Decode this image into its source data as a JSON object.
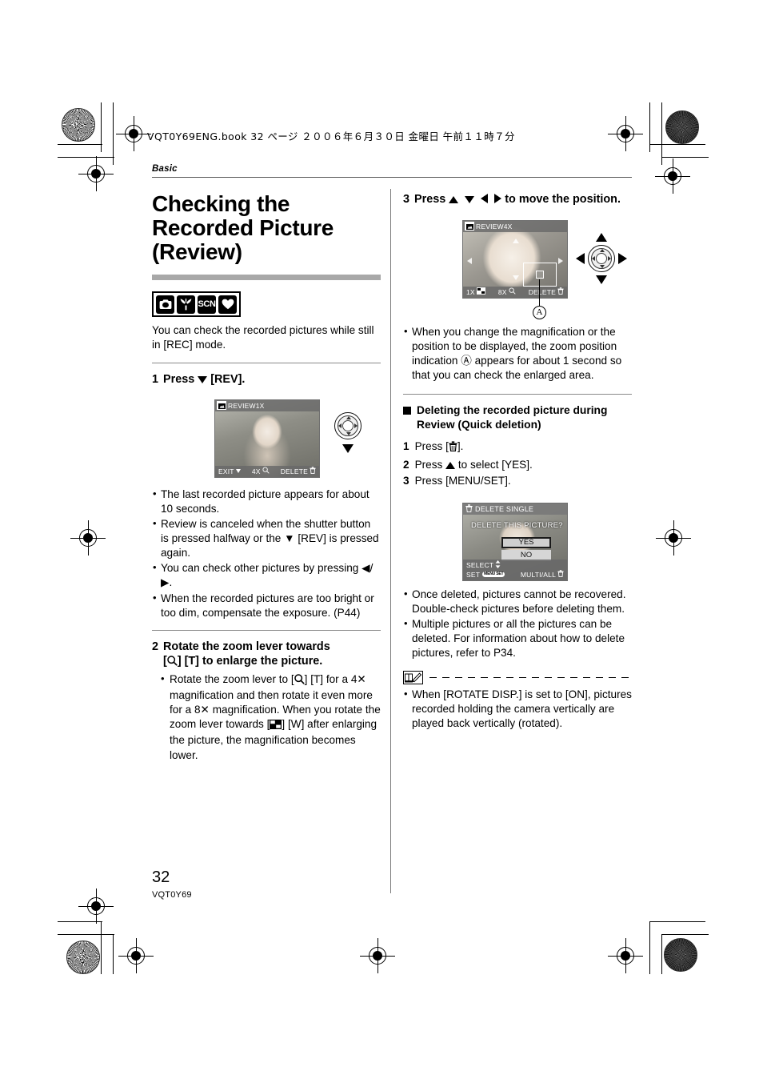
{
  "print_header": {
    "text": "VQT0Y69ENG.book   32 ページ   ２００６年６月３０日   金曜日   午前１１時７分"
  },
  "chapter": "Basic",
  "left_column": {
    "title": "Checking the Recorded Picture (Review)",
    "mode_icons": [
      {
        "name": "normal-picture-mode-icon",
        "glyph": "camera"
      },
      {
        "name": "macro-mode-icon",
        "glyph": "flower"
      },
      {
        "name": "scene-mode-icon",
        "glyph": "SCN"
      },
      {
        "name": "simple-mode-icon",
        "glyph": "heart"
      }
    ],
    "intro": "You can check the recorded pictures while still in [REC] mode.",
    "step1": {
      "num": "1",
      "text_before": "Press",
      "text_after": "[REV].",
      "lcd": {
        "label": "REVIEW1X",
        "bottom_left": "EXIT",
        "bottom_mid": "4X",
        "bottom_right": "DELETE"
      },
      "bullets": [
        "The last recorded picture appears for about 10 seconds.",
        "Review is canceled when the shutter button is pressed halfway or the ▼ [REV] is pressed again.",
        "You can check other pictures by pressing ◀/▶.",
        "When the recorded pictures are too bright or too dim, compensate the exposure. (P44)"
      ]
    },
    "step2": {
      "num": "2",
      "line1": "Rotate the zoom lever towards",
      "line2_before": "[",
      "line2_after": "] [T] to enlarge the picture.",
      "bullet_parts": {
        "p1": "Rotate the zoom lever to [",
        "p2": "] [T] for a 4✕ magnification and then rotate it even more for a 8✕ magnification. When you rotate the zoom lever towards [",
        "p3": "] [W] after enlarging the picture, the magnification becomes lower."
      }
    }
  },
  "right_column": {
    "step3": {
      "num": "3",
      "text_before": "Press",
      "text_after": "to move the position.",
      "lcd": {
        "label": "REVIEW4X",
        "bottom_left": "1X",
        "bottom_mid": "8X",
        "bottom_right": "DELETE"
      },
      "callout": "A",
      "bullets": [
        "When you change the magnification or the position to be displayed, the zoom position indication Ⓐ appears for about 1 second so that you can check the enlarged area."
      ]
    },
    "delete_section": {
      "heading": "Deleting the recorded picture during Review (Quick deletion)",
      "steps": [
        {
          "n": "1",
          "text_before": "Press [",
          "text_after": "]."
        },
        {
          "n": "2",
          "text_before": "Press",
          "text_after": "to select [YES]."
        },
        {
          "n": "3",
          "text": "Press [MENU/SET]."
        }
      ],
      "dialog": {
        "title": "DELETE SINGLE",
        "question": "DELETE THIS PICTURE?",
        "option_yes": "YES",
        "option_no": "NO",
        "footer_select": "SELECT",
        "footer_set": "SET",
        "footer_set_badge": "MENU SET",
        "footer_multi": "MULTI/ALL"
      },
      "bullets": [
        "Once deleted, pictures cannot be recovered. Double-check pictures before deleting them.",
        "Multiple pictures or all the pictures can be deleted. For information about how to delete pictures, refer to P34."
      ]
    },
    "note": {
      "icon_name": "note-book-pencil-icon",
      "bullets": [
        "When [ROTATE DISP.] is set to [ON], pictures recorded holding the camera vertically are played back vertically (rotated)."
      ]
    }
  },
  "footer": {
    "page_number": "32",
    "doc_code": "VQT0Y69"
  }
}
